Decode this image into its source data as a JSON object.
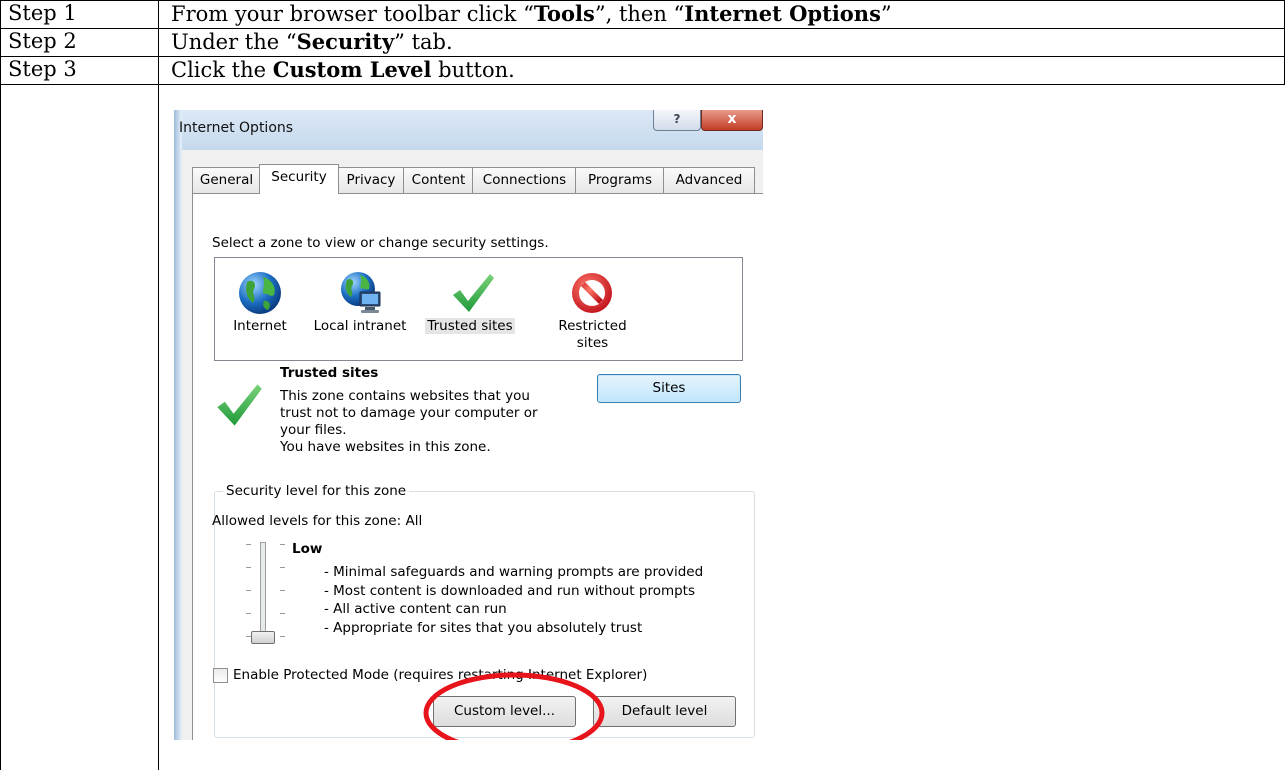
{
  "steps": [
    {
      "label": "Step 1",
      "text": [
        {
          "t": "From your browser toolbar click “",
          "b": false
        },
        {
          "t": "Tools",
          "b": true
        },
        {
          "t": "”, then “",
          "b": false
        },
        {
          "t": "Internet Options",
          "b": true
        },
        {
          "t": "”",
          "b": false
        }
      ]
    },
    {
      "label": "Step 2",
      "text": [
        {
          "t": "Under the “",
          "b": false
        },
        {
          "t": "Security",
          "b": true
        },
        {
          "t": "” tab.",
          "b": false
        }
      ]
    },
    {
      "label": "Step 3",
      "text": [
        {
          "t": "Click the ",
          "b": false
        },
        {
          "t": "Custom Level",
          "b": true
        },
        {
          "t": " button.",
          "b": false
        }
      ]
    }
  ],
  "dialog": {
    "title": "Internet Options",
    "help_glyph": "?",
    "close_glyph": "x",
    "tabs": [
      "General",
      "Security",
      "Privacy",
      "Content",
      "Connections",
      "Programs",
      "Advanced"
    ],
    "active_tab": "Security",
    "zone_prompt": "Select a zone to view or change security settings.",
    "zones": [
      {
        "label": "Internet",
        "icon": "globe-icon"
      },
      {
        "label": "Local intranet",
        "icon": "intranet-globe-icon"
      },
      {
        "label": "Trusted sites",
        "icon": "green-check-icon",
        "selected": true
      },
      {
        "label": "Restricted sites",
        "icon": "no-entry-icon"
      }
    ],
    "zone_label_restricted_line1": "Restricted",
    "zone_label_restricted_line2": "sites",
    "selected_zone": {
      "heading": "Trusted sites",
      "description_lines": [
        "This zone contains websites that you",
        "trust not to damage your computer or",
        "your files.",
        "You have websites in this zone."
      ]
    },
    "sites_button": "Sites",
    "security_level": {
      "group_title": "Security level for this zone",
      "allowed_levels": "Allowed levels for this zone: All",
      "level_name": "Low",
      "level_position": 0,
      "level_count": 5,
      "description_lines": [
        "- Minimal safeguards and warning prompts are provided",
        "- Most content is downloaded and run without prompts",
        "- All active content can run",
        "- Appropriate for sites that you absolutely trust"
      ]
    },
    "protected_mode": {
      "label": "Enable Protected Mode (requires restarting Internet Explorer)",
      "checked": false
    },
    "custom_level_button": "Custom level...",
    "default_level_button": "Default level",
    "highlight_color": "#e8141b"
  }
}
